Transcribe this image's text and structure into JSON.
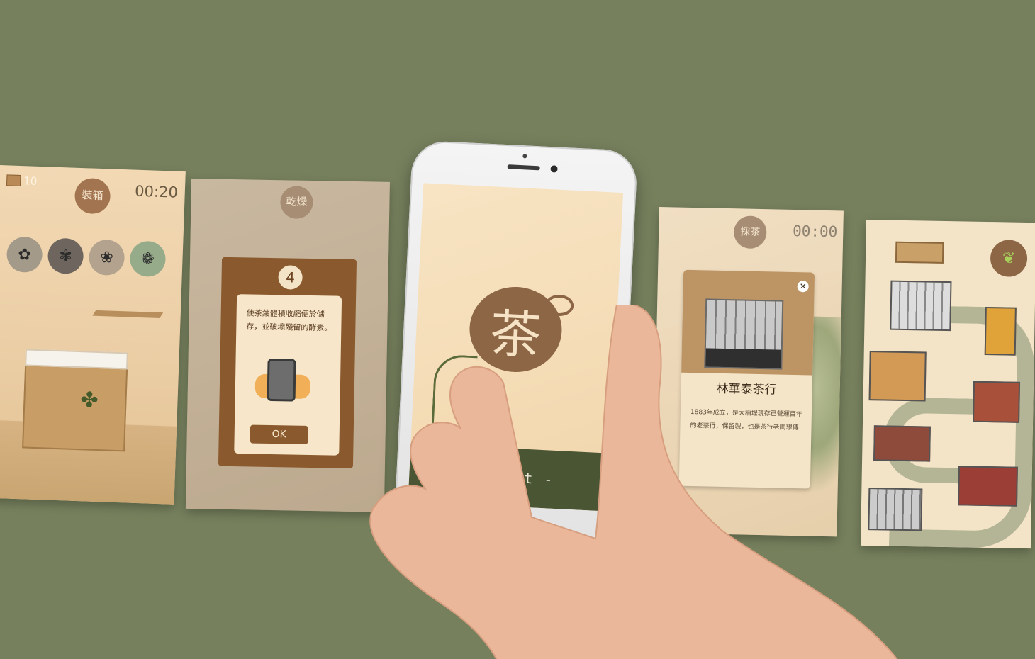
{
  "card1": {
    "badge": "裝箱",
    "timer": "00:20",
    "count": "10"
  },
  "card2": {
    "badge": "乾燥",
    "step": "4",
    "text": "使茶葉體積收縮便於儲存，並破壞殘留的酵素。",
    "ok_label": "OK"
  },
  "center": {
    "start_label": "- Start -",
    "logo_glyph": "茶"
  },
  "card4": {
    "badge": "採茶",
    "timer": "00:00",
    "title": "林華泰茶行",
    "desc": "1883年成立，是大稻埕現存已營運百年的老茶行，保留製，也是茶行老闆想傳"
  },
  "colors": {
    "background": "#76805d",
    "accent_brown": "#8d6646",
    "start_bar": "#4a5534"
  },
  "icons": {
    "close": "close-icon",
    "box": "box-icon",
    "tea_leaf": "tea-leaf-icon"
  }
}
